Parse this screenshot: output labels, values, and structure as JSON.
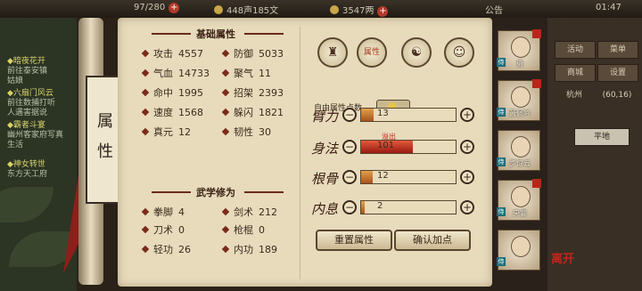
{
  "topbar": {
    "stamina": "97/280",
    "fame": "448声185文",
    "money": "3547两",
    "notice": "公告",
    "time": "01:47"
  },
  "quests": [
    {
      "title": "◆暗夜花开",
      "desc": "前往泰安镇"
    },
    {
      "title": "",
      "desc": "姑娘"
    },
    {
      "title": "◆六扇门风云",
      "desc": "前往数捕打听"
    },
    {
      "title": "",
      "desc": "人遇害据说"
    },
    {
      "title": "◆霸者斗宴",
      "desc": "幽州客家府写真"
    },
    {
      "title": "",
      "desc": "生活"
    },
    {
      "title": "◆神女转世",
      "desc": "东方天工府"
    }
  ],
  "scroll_title": "属性",
  "basic_title": "基础属性",
  "basic_stats": [
    {
      "label": "攻击",
      "value": "4557"
    },
    {
      "label": "防御",
      "value": "5033"
    },
    {
      "label": "气血",
      "value": "14733"
    },
    {
      "label": "聚气",
      "value": "11"
    },
    {
      "label": "命中",
      "value": "1995"
    },
    {
      "label": "招架",
      "value": "2393"
    },
    {
      "label": "速度",
      "value": "1568"
    },
    {
      "label": "躲闪",
      "value": "1821"
    },
    {
      "label": "真元",
      "value": "12"
    },
    {
      "label": "韧性",
      "value": "30"
    }
  ],
  "martial_title": "武学修为",
  "martial_stats": [
    {
      "label": "拳脚",
      "value": "4"
    },
    {
      "label": "剑术",
      "value": "212"
    },
    {
      "label": "刀术",
      "value": "0"
    },
    {
      "label": "枪棍",
      "value": "0"
    },
    {
      "label": "轻功",
      "value": "26"
    },
    {
      "label": "内功",
      "value": "189"
    }
  ],
  "icon_tabs": [
    {
      "icon": "hat-icon",
      "glyph": "♜"
    },
    {
      "icon": "attribute-chest-icon",
      "glyph": "属性"
    },
    {
      "icon": "yin-yang-icon",
      "glyph": "☯"
    },
    {
      "icon": "meridian-body-icon",
      "glyph": "☺"
    }
  ],
  "free_points_label": "自由属性点数",
  "free_points_value": "0",
  "attributes": [
    {
      "name": "臂力",
      "value": "13",
      "fill": 0.13,
      "red": false
    },
    {
      "name": "身法",
      "value": "101",
      "fill": 0.55,
      "red": true
    },
    {
      "name": "根骨",
      "value": "12",
      "fill": 0.12,
      "red": false
    },
    {
      "name": "内息",
      "value": "2",
      "fill": 0.04,
      "red": false
    }
  ],
  "overflow_label": "溢出",
  "reset_button": "重置属性",
  "confirm_button": "确认加点",
  "party": [
    {
      "name": "勇",
      "tag": "侍"
    },
    {
      "name": "萧佩吟",
      "tag": "侍"
    },
    {
      "name": "步惊云",
      "tag": "侍"
    },
    {
      "name": "央宴",
      "tag": "侍"
    },
    {
      "name": "",
      "tag": "侍"
    }
  ],
  "side_tabs": [
    "活动",
    "菜单",
    "商城",
    "设置",
    "杭州",
    "(60,16)"
  ],
  "side_region": "平地",
  "exit_label": "离开",
  "colors": {
    "accent": "#7a2b1a",
    "overflow": "#c0261b",
    "bar": "#e3a049"
  }
}
